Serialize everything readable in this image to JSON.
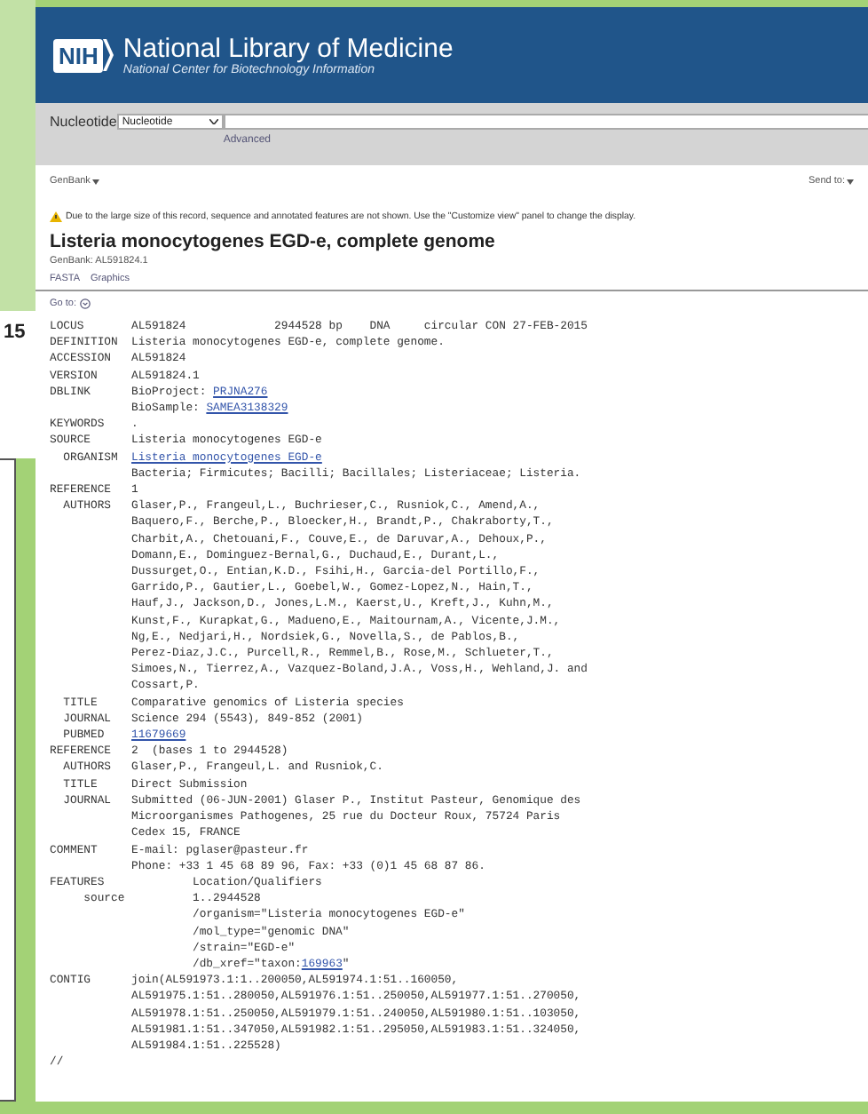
{
  "slide": {
    "number": "15"
  },
  "header": {
    "logo": "NIH",
    "title": "National Library of Medicine",
    "subtitle": "National Center for Biotechnology Information"
  },
  "search": {
    "database_label": "Nucleotide",
    "database_select": "Nucleotide",
    "advanced": "Advanced"
  },
  "toolbar": {
    "format": "GenBank",
    "send_to": "Send to:"
  },
  "notice": "Due to the large size of this record, sequence and annotated features are not shown. Use the \"Customize view\" panel to change the display.",
  "record_title": "Listeria monocytogenes EGD-e, complete genome",
  "accession": "GenBank: AL591824.1",
  "views": [
    "FASTA",
    "Graphics"
  ],
  "goto": "Go to:",
  "record": [
    {
      "key": "LOCUS",
      "kind": "field",
      "lines": [
        "AL591824             2944528 bp    DNA     circular CON 27-FEB-2015"
      ]
    },
    {
      "key": "DEFINITION",
      "kind": "field",
      "lines": [
        "Listeria monocytogenes EGD-e, complete genome."
      ]
    },
    {
      "key": "ACCESSION",
      "kind": "field",
      "lines": [
        "AL591824"
      ]
    },
    {
      "key": "VERSION",
      "kind": "field",
      "lines": [
        "AL591824.1"
      ]
    },
    {
      "key": "DBLINK",
      "kind": "field",
      "lines": [
        [
          {
            "text": "BioProject: ",
            "link": false
          },
          {
            "text": "PRJNA276",
            "link": true
          }
        ],
        [
          {
            "text": "BioSample: ",
            "link": false
          },
          {
            "text": "SAMEA3138329",
            "link": true
          }
        ]
      ]
    },
    {
      "key": "KEYWORDS",
      "kind": "field",
      "lines": [
        "."
      ]
    },
    {
      "key": "SOURCE",
      "kind": "field",
      "lines": [
        "Listeria monocytogenes EGD-e"
      ],
      "children": [
        {
          "key": "ORGANISM",
          "kind": "field",
          "lines": [
            [
              {
                "text": "Listeria monocytogenes EGD-e",
                "link": true
              }
            ],
            "Bacteria; Firmicutes; Bacilli; Bacillales; Listeriaceae; Listeria."
          ]
        }
      ]
    },
    {
      "key": "REFERENCE",
      "kind": "field",
      "lines": [
        "1"
      ],
      "children": [
        {
          "key": "AUTHORS",
          "kind": "field",
          "lines": [
            "Glaser,P., Frangeul,L., Buchrieser,C., Rusniok,C., Amend,A.,",
            "Baquero,F., Berche,P., Bloecker,H., Brandt,P., Chakraborty,T.,",
            "Charbit,A., Chetouani,F., Couve,E., de Daruvar,A., Dehoux,P.,",
            "Domann,E., Dominguez-Bernal,G., Duchaud,E., Durant,L.,",
            "Dussurget,O., Entian,K.D., Fsihi,H., Garcia-del Portillo,F.,",
            "Garrido,P., Gautier,L., Goebel,W., Gomez-Lopez,N., Hain,T.,",
            "Hauf,J., Jackson,D., Jones,L.M., Kaerst,U., Kreft,J., Kuhn,M.,",
            "Kunst,F., Kurapkat,G., Madueno,E., Maitournam,A., Vicente,J.M.,",
            "Ng,E., Nedjari,H., Nordsiek,G., Novella,S., de Pablos,B.,",
            "Perez-Diaz,J.C., Purcell,R., Remmel,B., Rose,M., Schlueter,T.,",
            "Simoes,N., Tierrez,A., Vazquez-Boland,J.A., Voss,H., Wehland,J. and",
            "Cossart,P."
          ]
        },
        {
          "key": "TITLE",
          "kind": "field",
          "lines": [
            "Comparative genomics of Listeria species"
          ]
        },
        {
          "key": "JOURNAL",
          "kind": "field",
          "lines": [
            "Science 294 (5543), 849-852 (2001)"
          ]
        },
        {
          "key": "PUBMED",
          "kind": "field",
          "lines": [
            [
              {
                "text": "11679669",
                "link": true
              }
            ]
          ]
        }
      ]
    },
    {
      "key": "REFERENCE",
      "kind": "field",
      "lines": [
        "2  (bases 1 to 2944528)"
      ],
      "children": [
        {
          "key": "AUTHORS",
          "kind": "field",
          "lines": [
            "Glaser,P., Frangeul,L. and Rusniok,C."
          ]
        },
        {
          "key": "TITLE",
          "kind": "field",
          "lines": [
            "Direct Submission"
          ]
        },
        {
          "key": "JOURNAL",
          "kind": "field",
          "lines": [
            "Submitted (06-JUN-2001) Glaser P., Institut Pasteur, Genomique des",
            "Microorganismes Pathogenes, 25 rue du Docteur Roux, 75724 Paris",
            "Cedex 15, FRANCE"
          ]
        }
      ]
    },
    {
      "key": "COMMENT",
      "kind": "field",
      "lines": [
        "E-mail: pglaser@pasteur.fr",
        "Phone: +33 1 45 68 89 96, Fax: +33 (0)1 45 68 87 86."
      ]
    },
    {
      "key": "FEATURES",
      "kind": "feature",
      "lines": [
        "Location/Qualifiers"
      ],
      "children": [
        {
          "key": "source",
          "kind": "feature",
          "lines": [
            "1..2944528",
            "/organism=\"Listeria monocytogenes EGD-e\"",
            "/mol_type=\"genomic DNA\"",
            "/strain=\"EGD-e\"",
            [
              {
                "text": "/db_xref=\"taxon:",
                "link": false
              },
              {
                "text": "169963",
                "link": true
              },
              {
                "text": "\"",
                "link": false
              }
            ]
          ]
        }
      ]
    },
    {
      "key": "CONTIG",
      "kind": "field",
      "lines": [
        "join(AL591973.1:1..200050,AL591974.1:51..160050,",
        "AL591975.1:51..280050,AL591976.1:51..250050,AL591977.1:51..270050,",
        "AL591978.1:51..250050,AL591979.1:51..240050,AL591980.1:51..103050,",
        "AL591981.1:51..347050,AL591982.1:51..295050,AL591983.1:51..324050,",
        "AL591984.1:51..225528)"
      ]
    }
  ],
  "end": "//"
}
